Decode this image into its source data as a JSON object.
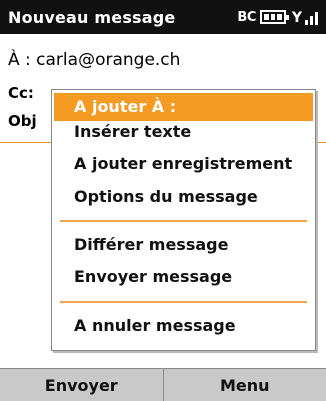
{
  "title": "Nouveau message",
  "status": {
    "bluetooth": "BC",
    "battery_level": 1.0,
    "signal_level": 1.0
  },
  "form": {
    "to_label": "À :",
    "to_value": "carla@orange.ch",
    "cc_label": "Cc:",
    "obj_label": "Obj"
  },
  "menu": {
    "items": [
      "A jouter À :",
      "Insérer texte",
      "A jouter enregistrement",
      "Options du message",
      "Différer message",
      "Envoyer message",
      "A nnuler message"
    ],
    "selected_index": 0
  },
  "softkeys": {
    "left": "Envoyer",
    "right": "Menu"
  },
  "colors": {
    "accent": "#f59a23",
    "titlebar": "#111111",
    "softkeys": "#c9c9c9"
  }
}
